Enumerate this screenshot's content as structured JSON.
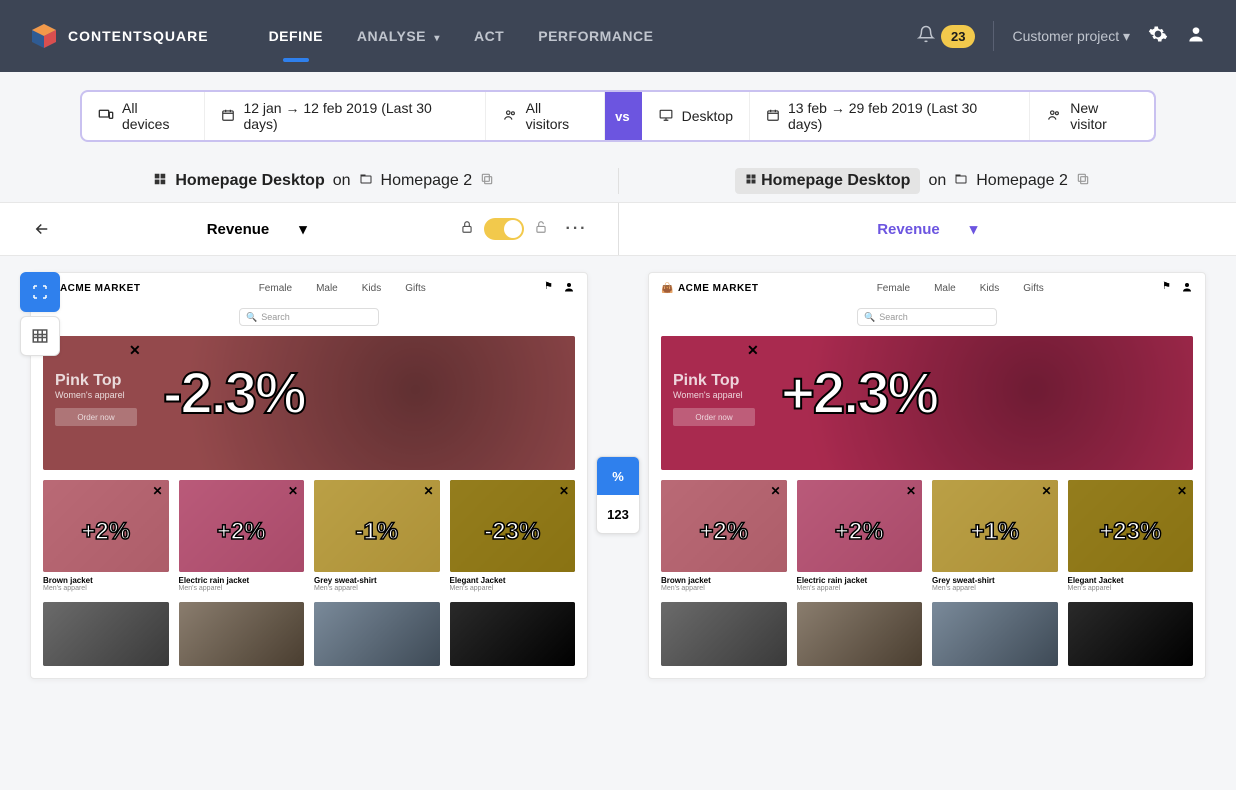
{
  "brand": "CONTENTSQUARE",
  "nav": {
    "items": [
      "DEFINE",
      "ANALYSE",
      "ACT",
      "PERFORMANCE"
    ],
    "active": 0,
    "notif_count": "23",
    "project": "Customer project"
  },
  "filter": {
    "a": {
      "device": "All devices",
      "date": "12 jan → 12 feb 2019 (Last 30 days)",
      "visitors": "All visitors"
    },
    "vs": "vs",
    "b": {
      "device": "Desktop",
      "date": "13 feb → 29 feb 2019 (Last 30 days)",
      "visitors": "New visitor"
    }
  },
  "context": {
    "left": {
      "zone": "Homepage Desktop",
      "on": "on",
      "page": "Homepage 2"
    },
    "right": {
      "zone": "Homepage Desktop",
      "on": "on",
      "page": "Homepage 2"
    }
  },
  "metric": {
    "left": "Revenue",
    "right": "Revenue"
  },
  "toggle": {
    "pct": "%",
    "num": "123"
  },
  "mock": {
    "brand": "ACME MARKET",
    "menu": [
      "Female",
      "Male",
      "Kids",
      "Gifts"
    ],
    "search": "Search",
    "hero": {
      "title": "Pink Top",
      "subtitle": "Women's apparel",
      "cta": "Order now",
      "left_value": "-2.3%",
      "right_value": "+2.3%"
    },
    "cards_left": [
      {
        "name": "Brown jacket",
        "sub": "Men's apparel",
        "value": "+2%",
        "overlay": "pink"
      },
      {
        "name": "Electric rain jacket",
        "sub": "Men's apparel",
        "value": "+2%",
        "overlay": "pink2"
      },
      {
        "name": "Grey sweat-shirt",
        "sub": "Men's apparel",
        "value": "-1%",
        "overlay": "yellow"
      },
      {
        "name": "Elegant Jacket",
        "sub": "Men's apparel",
        "value": "-23%",
        "overlay": "yellow2"
      }
    ],
    "cards_right": [
      {
        "name": "Brown jacket",
        "sub": "Men's apparel",
        "value": "+2%",
        "overlay": "pink"
      },
      {
        "name": "Electric rain jacket",
        "sub": "Men's apparel",
        "value": "+2%",
        "overlay": "pink2"
      },
      {
        "name": "Grey sweat-shirt",
        "sub": "Men's apparel",
        "value": "+1%",
        "overlay": "yellow"
      },
      {
        "name": "Elegant Jacket",
        "sub": "Men's apparel",
        "value": "+23%",
        "overlay": "yellow2"
      }
    ]
  }
}
